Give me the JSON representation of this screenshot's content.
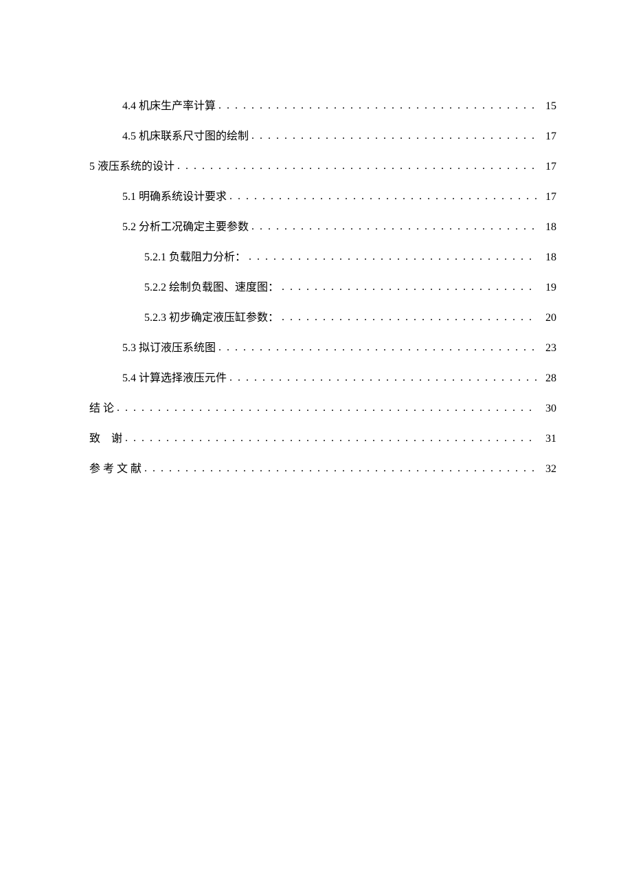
{
  "toc": {
    "entries": [
      {
        "label": "4.4 机床生产率计算",
        "page": "15",
        "indent": 1,
        "spaced": false
      },
      {
        "label": "4.5 机床联系尺寸图的绘制",
        "page": "17",
        "indent": 1,
        "spaced": false
      },
      {
        "label": "5 液压系统的设计",
        "page": "17",
        "indent": 0,
        "spaced": false
      },
      {
        "label": "5.1 明确系统设计要求",
        "page": "17",
        "indent": 1,
        "spaced": false
      },
      {
        "label": "5.2 分析工况确定主要参数",
        "page": "18",
        "indent": 1,
        "spaced": false
      },
      {
        "label": "5.2.1 负载阻力分析：",
        "page": "18",
        "indent": 2,
        "spaced": false
      },
      {
        "label": "5.2.2 绘制负载图、速度图：",
        "page": "19",
        "indent": 2,
        "spaced": false
      },
      {
        "label": "5.2.3 初步确定液压缸参数：",
        "page": "20",
        "indent": 2,
        "spaced": false
      },
      {
        "label": "5.3 拟订液压系统图",
        "page": "23",
        "indent": 1,
        "spaced": false
      },
      {
        "label": "5.4 计算选择液压元件",
        "page": "28",
        "indent": 1,
        "spaced": false
      },
      {
        "label": "结 论",
        "page": "30",
        "indent": 0,
        "spaced": true
      },
      {
        "label": "致　谢",
        "page": "31",
        "indent": 0,
        "spaced": true
      },
      {
        "label": "参 考 文 献",
        "page": "32",
        "indent": 0,
        "spaced": true
      }
    ]
  }
}
